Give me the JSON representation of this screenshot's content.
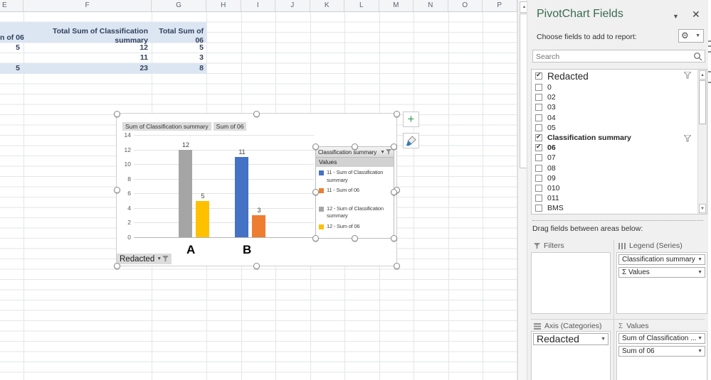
{
  "sheet": {
    "columns": [
      "E",
      "F",
      "G",
      "H",
      "I",
      "J",
      "K",
      "L",
      "M",
      "N",
      "O",
      "P"
    ],
    "scroll_up_arrow": "▲"
  },
  "pivot_table": {
    "col_e_fragment": "n of 06",
    "headers": [
      "Total Sum of Classification summary",
      "Total Sum of 06"
    ],
    "rows": [
      {
        "e": "5",
        "f": "12",
        "g": "5"
      },
      {
        "e": "",
        "f": "11",
        "g": "3"
      }
    ],
    "total": {
      "e": "5",
      "f": "23",
      "g": "8"
    }
  },
  "chart_data": {
    "type": "bar",
    "categories": [
      "A",
      "B"
    ],
    "series": [
      {
        "name": "11 - Sum of Classification summary",
        "color": "#4472c4",
        "values": [
          null,
          11
        ]
      },
      {
        "name": "11 - Sum of 06",
        "color": "#ed7d31",
        "values": [
          null,
          3
        ]
      },
      {
        "name": "12 - Sum of Classification summary",
        "color": "#a5a5a5",
        "values": [
          12,
          null
        ]
      },
      {
        "name": "12 - Sum of 06",
        "color": "#ffc000",
        "values": [
          5,
          null
        ]
      }
    ],
    "data_labels": [
      12,
      5,
      11,
      3
    ],
    "ylim": [
      0,
      14
    ],
    "ytick_step": 2,
    "grid": true,
    "legend_position": "right",
    "field_buttons": [
      "Sum of Classification summary",
      "Sum of 06"
    ],
    "axis_field_button": "Redacted",
    "legend": {
      "header": "Classification summary",
      "values_label": "Values"
    }
  },
  "chart_tools": {
    "add_element_button": "+",
    "style_button": "brush"
  },
  "panel": {
    "title": "PivotChart Fields",
    "choose_label": "Choose fields to add to report:",
    "search_placeholder": "Search",
    "fields": [
      {
        "label": "Redacted",
        "checked": true,
        "bold": false,
        "big": true,
        "filter": true
      },
      {
        "label": "0",
        "checked": false
      },
      {
        "label": "02",
        "checked": false
      },
      {
        "label": "03",
        "checked": false
      },
      {
        "label": "04",
        "checked": false
      },
      {
        "label": "05",
        "checked": false
      },
      {
        "label": "Classification summary",
        "checked": true,
        "bold": true,
        "filter": true
      },
      {
        "label": "06",
        "checked": true,
        "bold": true
      },
      {
        "label": "07",
        "checked": false
      },
      {
        "label": "08",
        "checked": false
      },
      {
        "label": "09",
        "checked": false
      },
      {
        "label": "010",
        "checked": false
      },
      {
        "label": "011",
        "checked": false
      },
      {
        "label": "BMS",
        "checked": false
      }
    ],
    "drag_label": "Drag fields between areas below:",
    "areas": {
      "filters": {
        "title": "Filters",
        "pills": []
      },
      "legend": {
        "title": "Legend (Series)",
        "pills": [
          "Classification summary",
          "Σ Values"
        ]
      },
      "axis": {
        "title": "Axis (Categories)",
        "pills": [
          "Redacted"
        ]
      },
      "values": {
        "title": "Values",
        "pills": [
          "Sum of Classification ...",
          "Sum of 06"
        ]
      }
    }
  },
  "colors": {
    "pivot_band": "#dce6f2",
    "panel_title": "#3a6b52",
    "bar_blue": "#4472c4",
    "bar_orange": "#ed7d31",
    "bar_gray": "#a5a5a5",
    "bar_yellow": "#ffc000"
  }
}
